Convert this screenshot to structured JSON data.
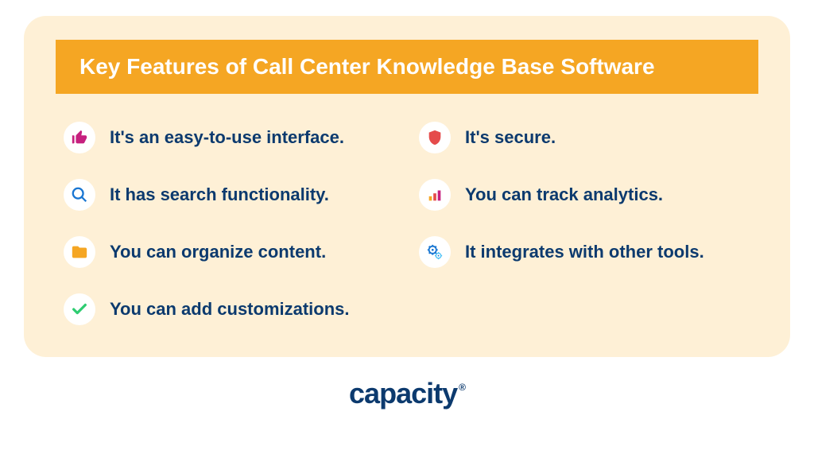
{
  "header": {
    "title": "Key Features of Call Center Knowledge Base Software"
  },
  "features": {
    "left": [
      {
        "icon": "thumbs-up",
        "text": "It's an easy-to-use interface."
      },
      {
        "icon": "search",
        "text": "It has search functionality."
      },
      {
        "icon": "folder",
        "text": "You can organize content."
      },
      {
        "icon": "check",
        "text": "You can add customizations."
      }
    ],
    "right": [
      {
        "icon": "shield",
        "text": "It's secure."
      },
      {
        "icon": "chart",
        "text": "You can track analytics."
      },
      {
        "icon": "gear",
        "text": "It integrates with other tools."
      }
    ]
  },
  "brand": {
    "name": "capacity",
    "registered": "®"
  },
  "colors": {
    "accent": "#F5A623",
    "cardBg": "#FEF0D6",
    "textDark": "#0C3A6E"
  }
}
